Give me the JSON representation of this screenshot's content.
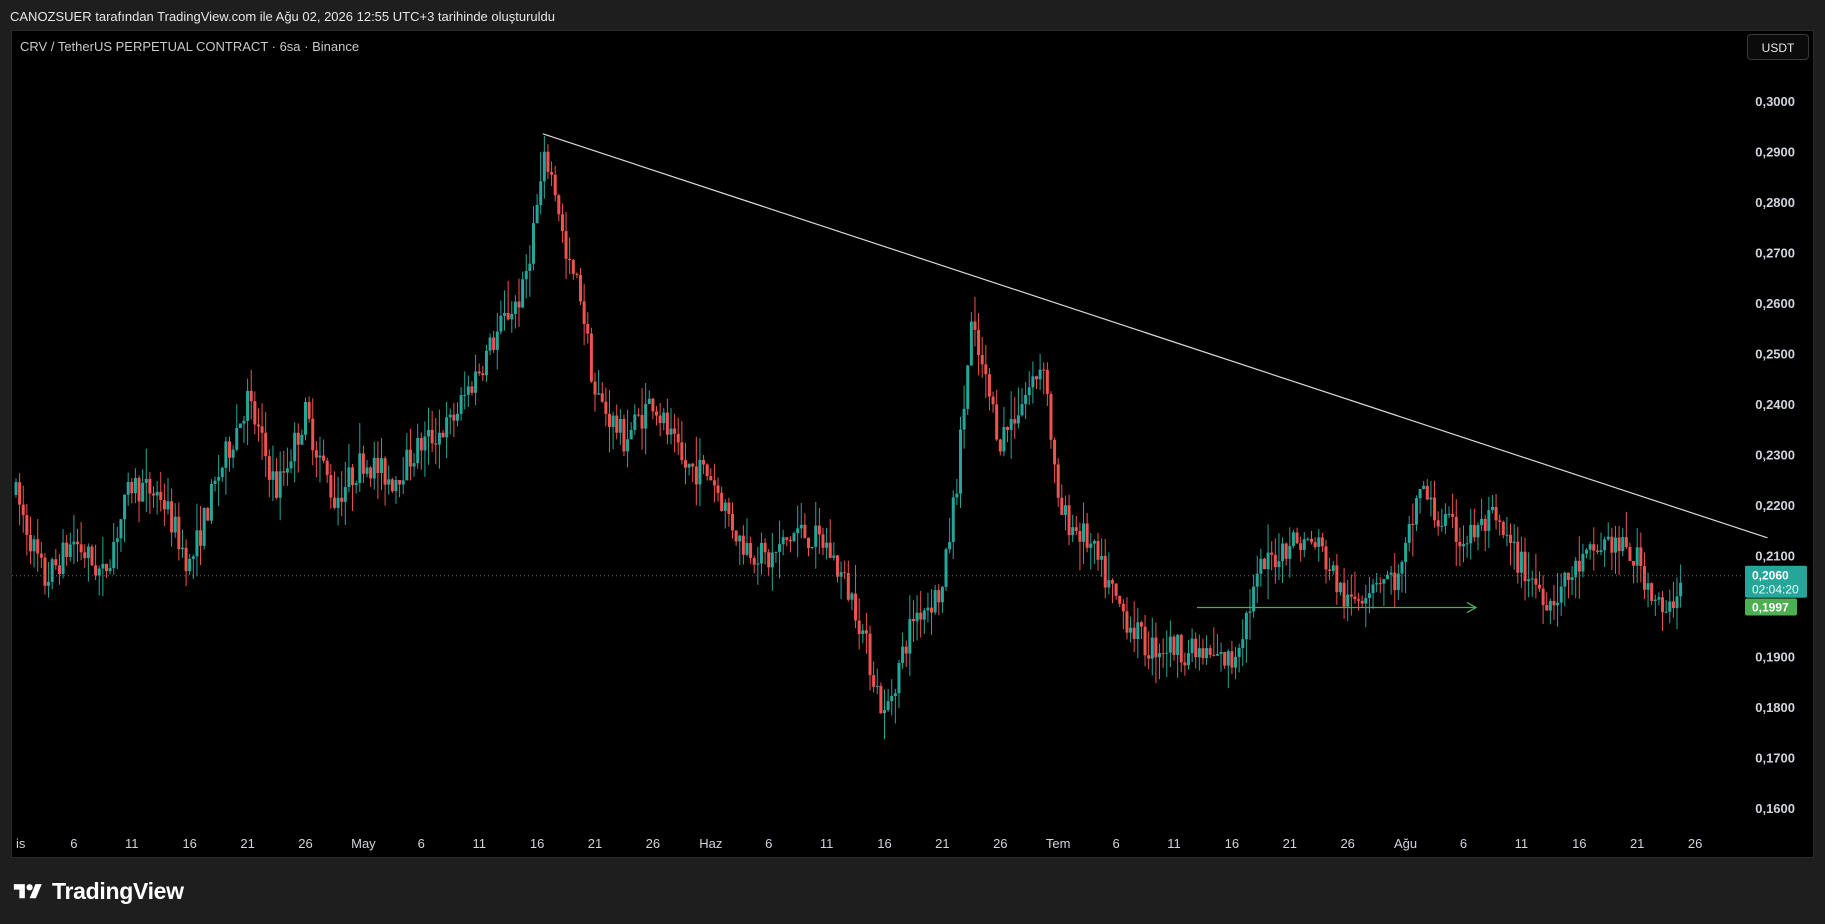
{
  "header": {
    "caption": "CANOZSUER tarafından TradingView.com ile Ağu 02, 2026 12:55 UTC+3 tarihinde oluşturuldu"
  },
  "chart_header": {
    "symbol": "CRV / TetherUS PERPETUAL CONTRACT · 6sa · Binance",
    "currency": "USDT"
  },
  "colors": {
    "background": "#000000",
    "up": "#26a69a",
    "down": "#ef5350",
    "trendline": "#d9d9d9",
    "support": "#4caf50",
    "price_label": "#26a69a",
    "support_label": "#4caf50",
    "axis_text": "#d1d4dc"
  },
  "brand": {
    "name": "TradingView",
    "icon": "tradingview-logo-icon"
  },
  "chart_data": {
    "type": "candlestick",
    "title": "CRV / TetherUS PERPETUAL CONTRACT · 6sa · Binance",
    "ylim": [
      0.155,
      0.308
    ],
    "y_ticks": [
      "0,3000",
      "0,2900",
      "0,2800",
      "0,2700",
      "0,2600",
      "0,2500",
      "0,2400",
      "0,2300",
      "0,2200",
      "0,2100",
      "0,1900",
      "0,1800",
      "0,1700",
      "0,1600"
    ],
    "x_ticks": [
      "is",
      "6",
      "11",
      "16",
      "21",
      "26",
      "May",
      "6",
      "11",
      "16",
      "21",
      "26",
      "Haz",
      "6",
      "11",
      "16",
      "21",
      "26",
      "Tem",
      "6",
      "11",
      "16",
      "21",
      "26",
      "Ağu",
      "6",
      "11",
      "16",
      "21",
      "26"
    ],
    "x_domain": [
      0,
      29
    ],
    "series": [
      {
        "values": [
          [
            0.0,
            0.222
          ],
          [
            1.0,
            0.205
          ],
          [
            2.0,
            0.213
          ],
          [
            3.0,
            0.206
          ],
          [
            4.0,
            0.224
          ],
          [
            5.0,
            0.222
          ],
          [
            6.0,
            0.208
          ],
          [
            7.0,
            0.226
          ],
          [
            8.0,
            0.241
          ],
          [
            9.0,
            0.223
          ],
          [
            10.0,
            0.238
          ],
          [
            11.0,
            0.221
          ],
          [
            12.0,
            0.229
          ],
          [
            13.0,
            0.225
          ],
          [
            14.0,
            0.232
          ],
          [
            15.0,
            0.236
          ],
          [
            16.0,
            0.247
          ],
          [
            17.0,
            0.258
          ],
          [
            17.5,
            0.262
          ],
          [
            18.0,
            0.279
          ],
          [
            18.3,
            0.289
          ],
          [
            18.7,
            0.281
          ],
          [
            19.0,
            0.268
          ],
          [
            19.5,
            0.262
          ],
          [
            20.0,
            0.242
          ],
          [
            21.0,
            0.233
          ],
          [
            22.0,
            0.241
          ],
          [
            23.0,
            0.228
          ],
          [
            24.0,
            0.226
          ],
          [
            25.0,
            0.213
          ],
          [
            26.0,
            0.209
          ],
          [
            27.0,
            0.215
          ],
          [
            28.0,
            0.212
          ],
          [
            29.0,
            0.2
          ],
          [
            30.0,
            0.178
          ],
          [
            31.0,
            0.198
          ],
          [
            32.0,
            0.203
          ],
          [
            32.5,
            0.225
          ],
          [
            33.0,
            0.255
          ],
          [
            34.0,
            0.233
          ],
          [
            35.0,
            0.243
          ],
          [
            35.5,
            0.249
          ],
          [
            36.0,
            0.219
          ],
          [
            37.0,
            0.213
          ],
          [
            38.0,
            0.201
          ],
          [
            39.0,
            0.192
          ],
          [
            40.0,
            0.192
          ],
          [
            41.0,
            0.19
          ],
          [
            42.0,
            0.189
          ],
          [
            43.0,
            0.207
          ],
          [
            44.0,
            0.213
          ],
          [
            45.0,
            0.212
          ],
          [
            46.0,
            0.2
          ],
          [
            47.0,
            0.206
          ],
          [
            47.8,
            0.205
          ],
          [
            48.5,
            0.224
          ],
          [
            49.0,
            0.218
          ],
          [
            50.0,
            0.213
          ],
          [
            51.0,
            0.217
          ],
          [
            52.0,
            0.208
          ],
          [
            53.0,
            0.201
          ],
          [
            54.0,
            0.208
          ],
          [
            55.0,
            0.213
          ],
          [
            56.0,
            0.209
          ],
          [
            57.0,
            0.197
          ],
          [
            57.5,
            0.206
          ]
        ]
      }
    ],
    "last_price": "0,2060",
    "countdown": "02:04:20",
    "support_price": "0,1997",
    "support_value": 0.1997,
    "trendline": {
      "from": [
        18.2,
        0.2935
      ],
      "to": [
        30.2,
        0.2655
      ],
      "to_end": [
        60.5,
        0.2135
      ]
    }
  }
}
